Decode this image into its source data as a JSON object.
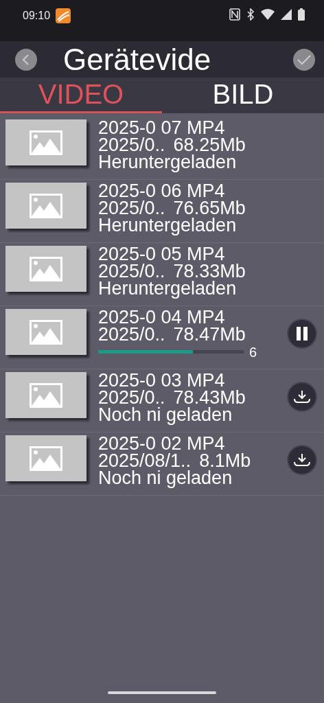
{
  "status_bar": {
    "time": "09:10"
  },
  "header": {
    "title": "Gerätevide"
  },
  "tabs": [
    {
      "label": "VIDEO",
      "selected": true
    },
    {
      "label": "BILD",
      "selected": false
    }
  ],
  "files": [
    {
      "name": "2025-0  07 MP4",
      "date": "2025/0..",
      "size": "68.25Mb",
      "kind": "done",
      "status": "Heruntergeladen"
    },
    {
      "name": "2025-0  06 MP4",
      "date": "2025/0..",
      "size": "76.65Mb",
      "kind": "done",
      "status": "Heruntergeladen"
    },
    {
      "name": "2025-0  05 MP4",
      "date": "2025/0..",
      "size": "78.33Mb",
      "kind": "done",
      "status": "Heruntergeladen"
    },
    {
      "name": "2025-0  04 MP4",
      "date": "2025/0..",
      "size": "78.47Mb",
      "kind": "downloading",
      "level": 0.65,
      "percent": "6"
    },
    {
      "name": "2025-0  03 MP4",
      "date": "2025/0..",
      "size": "78.43Mb",
      "kind": "pending",
      "status": "Noch ni  geladen"
    },
    {
      "name": "2025-0  02 MP4",
      "date": "2025/08/1..",
      "size": "8.1Mb",
      "kind": "pending",
      "status": "Noch ni  geladen"
    }
  ]
}
